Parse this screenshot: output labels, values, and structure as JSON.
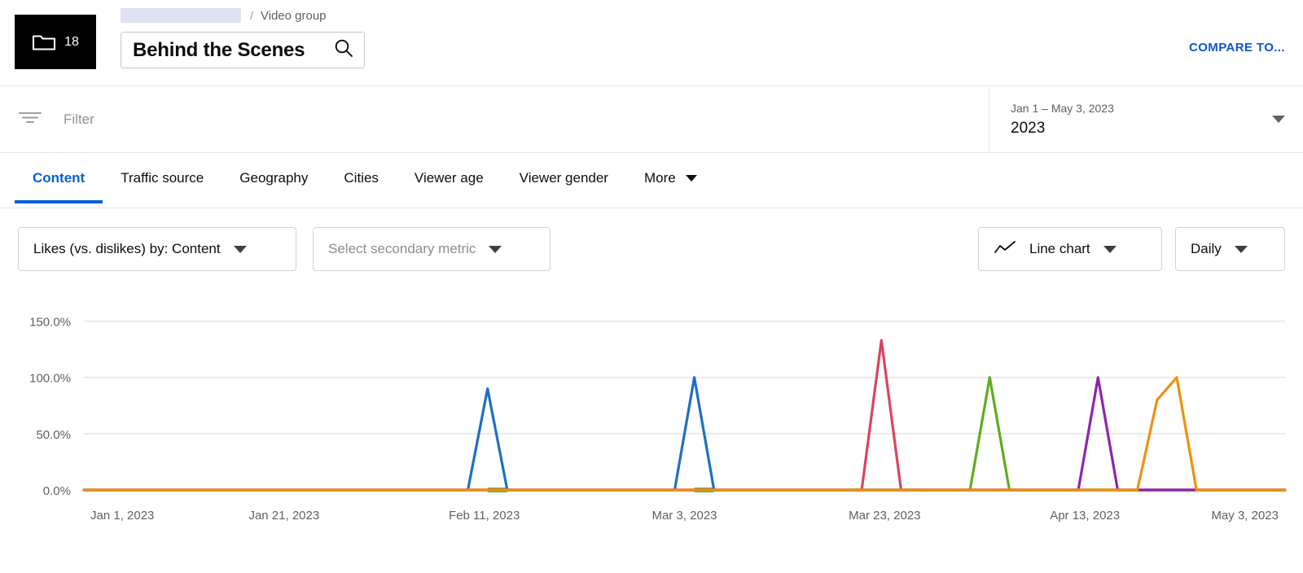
{
  "header": {
    "thumb_count": "18",
    "folder_icon": "folder-icon",
    "breadcrumb_separator": "/",
    "breadcrumb_type": "Video group",
    "group_name": "Behind the Scenes",
    "search_icon": "search-icon",
    "compare_label": "COMPARE TO..."
  },
  "filterbar": {
    "filter_icon": "filter-icon",
    "filter_placeholder": "Filter",
    "date_range": "Jan 1 – May 3, 2023",
    "date_preset": "2023",
    "date_caret_icon": "chevron-down-icon"
  },
  "tabs": [
    {
      "label": "Content",
      "active": true
    },
    {
      "label": "Traffic source",
      "active": false
    },
    {
      "label": "Geography",
      "active": false
    },
    {
      "label": "Cities",
      "active": false
    },
    {
      "label": "Viewer age",
      "active": false
    },
    {
      "label": "Viewer gender",
      "active": false
    },
    {
      "label": "More",
      "active": false,
      "caret": true
    }
  ],
  "controls": {
    "primary_metric": "Likes (vs. dislikes) by: Content",
    "secondary_metric_placeholder": "Select secondary metric",
    "chart_type": "Line chart",
    "chart_type_icon": "line-chart-icon",
    "granularity": "Daily",
    "caret_icon": "chevron-down-icon"
  },
  "chart_data": {
    "type": "line",
    "title": "",
    "xlabel": "",
    "ylabel": "",
    "ylim": [
      0,
      162
    ],
    "yticks": [
      0,
      50,
      100,
      150
    ],
    "ytick_labels": [
      "0.0%",
      "50.0%",
      "100.0%",
      "150.0%"
    ],
    "xtick_labels": [
      "Jan 1, 2023",
      "Jan 21, 2023",
      "Feb 11, 2023",
      "Mar 3, 2023",
      "Mar 23, 2023",
      "Apr 13, 2023",
      "May 3, 2023"
    ],
    "x_start": "2023-01-01",
    "x_end": "2023-05-03",
    "x_days": 122,
    "grid": true,
    "legend": "none",
    "series": [
      {
        "name": "series-blue",
        "color": "#1f6fc4",
        "points": [
          {
            "day": 0,
            "value": 0
          },
          {
            "day": 39,
            "value": 0
          },
          {
            "day": 41,
            "value": 90
          },
          {
            "day": 43,
            "value": 0
          },
          {
            "day": 60,
            "value": 0
          },
          {
            "day": 62,
            "value": 100
          },
          {
            "day": 64,
            "value": 0
          },
          {
            "day": 122,
            "value": 0
          }
        ]
      },
      {
        "name": "series-red",
        "color": "#d9455f",
        "points": [
          {
            "day": 0,
            "value": 0
          },
          {
            "day": 79,
            "value": 0
          },
          {
            "day": 81,
            "value": 133
          },
          {
            "day": 83,
            "value": 0
          },
          {
            "day": 122,
            "value": 0
          }
        ]
      },
      {
        "name": "series-green",
        "color": "#5fad1e",
        "points": [
          {
            "day": 0,
            "value": 0
          },
          {
            "day": 90,
            "value": 0
          },
          {
            "day": 92,
            "value": 100
          },
          {
            "day": 94,
            "value": 0
          },
          {
            "day": 122,
            "value": 0
          }
        ]
      },
      {
        "name": "series-purple",
        "color": "#8e24aa",
        "points": [
          {
            "day": 0,
            "value": 0
          },
          {
            "day": 101,
            "value": 0
          },
          {
            "day": 103,
            "value": 100
          },
          {
            "day": 105,
            "value": 0
          },
          {
            "day": 122,
            "value": 0
          }
        ]
      },
      {
        "name": "series-orange",
        "color": "#ef9012",
        "points": [
          {
            "day": 0,
            "value": 0
          },
          {
            "day": 107,
            "value": 0
          },
          {
            "day": 109,
            "value": 80
          },
          {
            "day": 111,
            "value": 100
          },
          {
            "day": 113,
            "value": 0
          },
          {
            "day": 122,
            "value": 0
          }
        ]
      }
    ],
    "baseline_highlights": [
      {
        "name": "green-baseline-1",
        "color": "#7cb342",
        "day_start": 41,
        "day_end": 43
      },
      {
        "name": "green-baseline-2",
        "color": "#7cb342",
        "day_start": 62,
        "day_end": 64
      }
    ]
  }
}
